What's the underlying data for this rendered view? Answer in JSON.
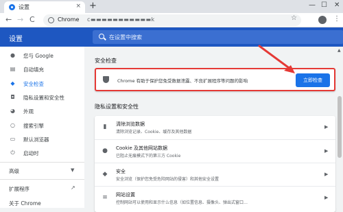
{
  "tab": {
    "title": "设置",
    "close": "×"
  },
  "new_tab": "+",
  "window": {
    "minimize": "—",
    "maximize": "☐",
    "close": "✕"
  },
  "toolbar": {
    "back": "←",
    "forward": "→",
    "reload": "C",
    "site_label": "Chrome",
    "url": "c▬▬▬▬▬▬▬▬▬▬▬k",
    "star": "☆",
    "menu": "⋮"
  },
  "header": {
    "title": "设置",
    "search_placeholder": "在设置中搜索"
  },
  "sidebar": {
    "items": [
      {
        "label": "您与 Google",
        "icon": "person-icon"
      },
      {
        "label": "自动填充",
        "icon": "clipboard-icon"
      },
      {
        "label": "安全检查",
        "icon": "shield-icon",
        "active": true
      },
      {
        "label": "隐私设置和安全性",
        "icon": "privacy-shield-icon"
      },
      {
        "label": "外观",
        "icon": "palette-icon"
      },
      {
        "label": "搜索引擎",
        "icon": "search-icon"
      },
      {
        "label": "默认浏览器",
        "icon": "browser-icon"
      },
      {
        "label": "启动时",
        "icon": "power-icon"
      }
    ],
    "advanced": "高级",
    "extensions": "扩展程序",
    "about": "关于 Chrome"
  },
  "main": {
    "safety_title": "安全检查",
    "safety_text": "Chrome 有助于保护您免受数据泄露、不良扩展程序等问题的影响",
    "safety_button": "立即检查",
    "privacy_title": "隐私设置和安全性",
    "privacy_rows": [
      {
        "title": "清除浏览数据",
        "desc": "清除浏览记录、Cookie、缓存及其他数据",
        "icon": "trash-icon"
      },
      {
        "title": "Cookie 及其他网站数据",
        "desc": "已阻止无痕模式下的第三方 Cookie",
        "icon": "cookie-icon"
      },
      {
        "title": "安全",
        "desc": "安全浏览（保护您免受危险网站的侵害）和其他安全设置",
        "icon": "shield-icon"
      },
      {
        "title": "网站设置",
        "desc": "控制网站可以使用和显示什么信息（如位置信息、摄像头、弹出式窗口…",
        "icon": "sliders-icon"
      }
    ]
  },
  "colors": {
    "accent": "#1a73e8",
    "header": "#1e57c1",
    "annotation": "#e53935"
  }
}
